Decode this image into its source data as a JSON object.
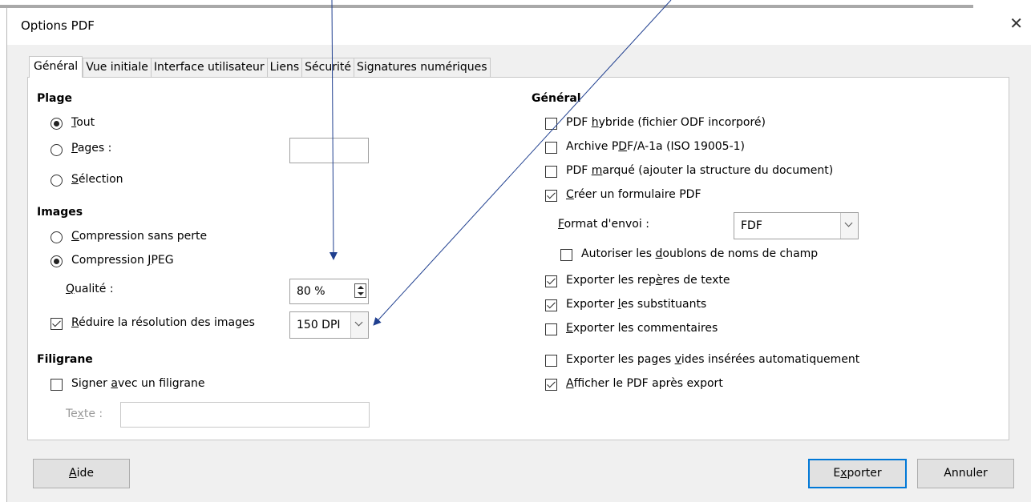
{
  "window": {
    "title": "Options PDF",
    "close_glyph": "✕"
  },
  "tabs": [
    {
      "label": "Général",
      "active": true
    },
    {
      "label": "Vue initiale"
    },
    {
      "label": "Interface utilisateur"
    },
    {
      "label": "Liens"
    },
    {
      "label": "Sécurité"
    },
    {
      "label": "Signatures numériques"
    }
  ],
  "range": {
    "heading": "Plage",
    "all": {
      "pre": "",
      "mn": "T",
      "post": "out",
      "selected": true
    },
    "pages": {
      "pre": "",
      "mn": "P",
      "post": "ages :",
      "selected": false,
      "value": ""
    },
    "selection": {
      "pre": "",
      "mn": "S",
      "post": "élection",
      "selected": false
    }
  },
  "images": {
    "heading": "Images",
    "lossless": {
      "pre": "",
      "mn": "C",
      "post": "ompression sans perte",
      "selected": false
    },
    "jpeg": {
      "pre": "Compression ",
      "mn": "J",
      "post": "PEG",
      "selected": true
    },
    "quality": {
      "pre": "",
      "mn": "Q",
      "post": "ualité :",
      "value": "80 %"
    },
    "reduce": {
      "pre": "",
      "mn": "R",
      "post": "éduire la résolution des images",
      "checked": true,
      "value": "150 DPI"
    }
  },
  "watermark": {
    "heading": "Filigrane",
    "sign": {
      "pre": "Signer ",
      "mn": "a",
      "post": "vec un filigrane",
      "checked": false
    },
    "text": {
      "pre": "Te",
      "mn": "x",
      "post": "te :",
      "value": ""
    }
  },
  "general": {
    "heading": "Général",
    "hybrid": {
      "pre": "PDF ",
      "mn": "h",
      "post": "ybride (fichier ODF incorporé)",
      "checked": false
    },
    "archive": {
      "pre": "Archive P",
      "mn": "D",
      "post": "F/A-1a (ISO 19005-1)",
      "checked": false
    },
    "tagged": {
      "pre": "PDF ",
      "mn": "m",
      "post": "arqué (ajouter la structure du document)",
      "checked": false
    },
    "form": {
      "pre": "",
      "mn": "C",
      "post": "réer un formulaire PDF",
      "checked": true
    },
    "submit_format": {
      "pre": "",
      "mn": "F",
      "post": "ormat d'envoi :",
      "value": "FDF"
    },
    "duplicates": {
      "pre": "Autoriser les ",
      "mn": "d",
      "post": "oublons de noms de champ",
      "checked": false
    },
    "bookmarks": {
      "pre": "Exporter les rep",
      "mn": "è",
      "post": "res de texte",
      "checked": true
    },
    "placeholders": {
      "pre": "Exporter ",
      "mn": "l",
      "post": "es substituants",
      "checked": true
    },
    "comments": {
      "pre": "",
      "mn": "E",
      "post": "xporter les commentaires",
      "checked": false
    },
    "empty_pages": {
      "pre": "Exporter les pages ",
      "mn": "v",
      "post": "ides insérées automatiquement",
      "checked": false
    },
    "view_after": {
      "pre": "",
      "mn": "A",
      "post": "fficher le PDF après export",
      "checked": true
    }
  },
  "buttons": {
    "help": {
      "pre": "",
      "mn": "A",
      "post": "ide"
    },
    "export": {
      "pre": "E",
      "mn": "x",
      "post": "porter"
    },
    "cancel": {
      "pre": "Annuler",
      "mn": "",
      "post": ""
    }
  },
  "colors": {
    "arrow": "#1f3f8f",
    "accent": "#0078d7"
  }
}
